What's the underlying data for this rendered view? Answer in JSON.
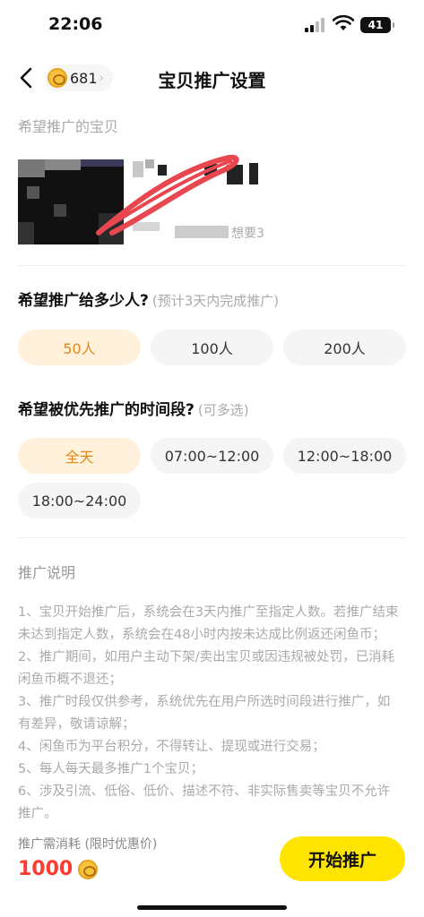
{
  "status": {
    "time": "22:06",
    "battery": "41"
  },
  "nav": {
    "coins": "681",
    "title": "宝贝推广设置"
  },
  "item": {
    "section_label": "希望推广的宝贝",
    "want": "想要3"
  },
  "people": {
    "question_prefix": "希望推广给多少人?",
    "hint": "(预计3天内完成推广)",
    "options": [
      "50人",
      "100人",
      "200人"
    ],
    "selected": "50人"
  },
  "time": {
    "question": "希望被优先推广的时间段?",
    "hint": "(可多选)",
    "options": [
      "全天",
      "07:00~12:00",
      "12:00~18:00",
      "18:00~24:00"
    ],
    "selected": "全天"
  },
  "desc": {
    "title": "推广说明",
    "lines": [
      "1、宝贝开始推广后，系统会在3天内推广至指定人数。若推广结束未达到指定人数，系统会在48小时内按未达成比例返还闲鱼币；",
      "2、推广期间，如用户主动下架/卖出宝贝或因违规被处罚，已消耗闲鱼币概不退还；",
      "3、推广时段仅供参考，系统优先在用户所选时间段进行推广，如有差异，敬请谅解；",
      "4、闲鱼币为平台积分，不得转让、提现或进行交易；",
      "5、每人每天最多推广1个宝贝；",
      "6、涉及引流、低俗、低价、描述不符、非实际售卖等宝贝不允许推广。"
    ]
  },
  "bottom": {
    "cost_label": "推广需消耗 (限时优惠价)",
    "cost": "1000",
    "start_label": "开始推广"
  },
  "colors": {
    "accent_yellow": "#ffe400",
    "selected_bg": "#fff1dc",
    "selected_text": "#e0891a",
    "price_red": "#ff3b30"
  }
}
